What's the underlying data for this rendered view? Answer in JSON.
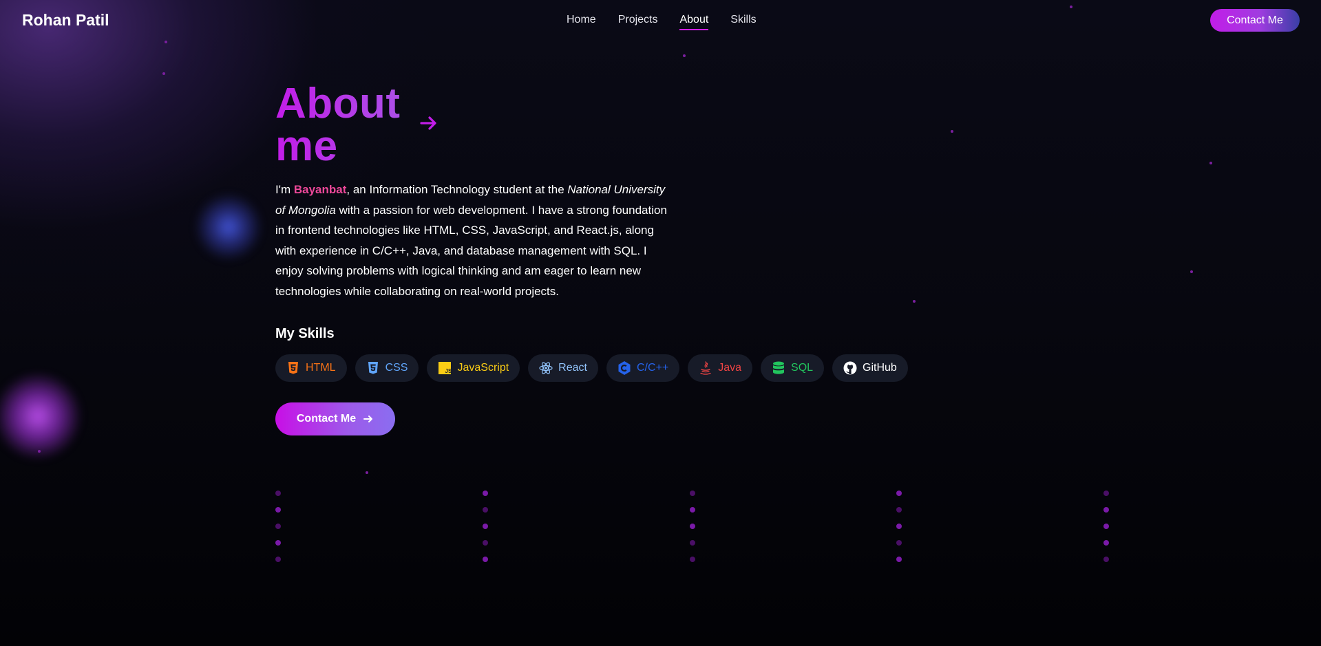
{
  "nav": {
    "brand": "Rohan Patil",
    "links": [
      "Home",
      "Projects",
      "About",
      "Skills"
    ],
    "active": "About",
    "cta_label": "Contact Me"
  },
  "hero": {
    "title_line1": "About",
    "title_line2": "me",
    "bio": {
      "intro": "I'm ",
      "name": "Bayanbat",
      "part2": ", an Information Technology student at the ",
      "university": "National University of Mongolia",
      "part3": " with a passion for web development. I have a strong foundation in frontend technologies like HTML, CSS, JavaScript, and React.js, along with experience in C/C++, Java, and database management with SQL. I enjoy solving problems with logical thinking and am eager to learn new technologies while collaborating on real-world projects."
    },
    "skills_heading": "My Skills",
    "skills": [
      {
        "label": "HTML",
        "icon": "html5-icon",
        "color": "#f97316"
      },
      {
        "label": "CSS",
        "icon": "css3-icon",
        "color": "#60a5fa"
      },
      {
        "label": "JavaScript",
        "icon": "javascript-icon",
        "color": "#facc15"
      },
      {
        "label": "React",
        "icon": "react-icon",
        "color": "#93c5fd"
      },
      {
        "label": "C/C++",
        "icon": "cplusplus-icon",
        "color": "#2563eb"
      },
      {
        "label": "Java",
        "icon": "java-icon",
        "color": "#ef4444"
      },
      {
        "label": "SQL",
        "icon": "database-icon",
        "color": "#22c55e"
      },
      {
        "label": "GitHub",
        "icon": "github-icon",
        "color": "#ffffff"
      }
    ],
    "cta_label": "Contact Me"
  },
  "theme": {
    "accent": "#c21de8",
    "name_highlight": "#ec4899",
    "background": "#05050b"
  }
}
